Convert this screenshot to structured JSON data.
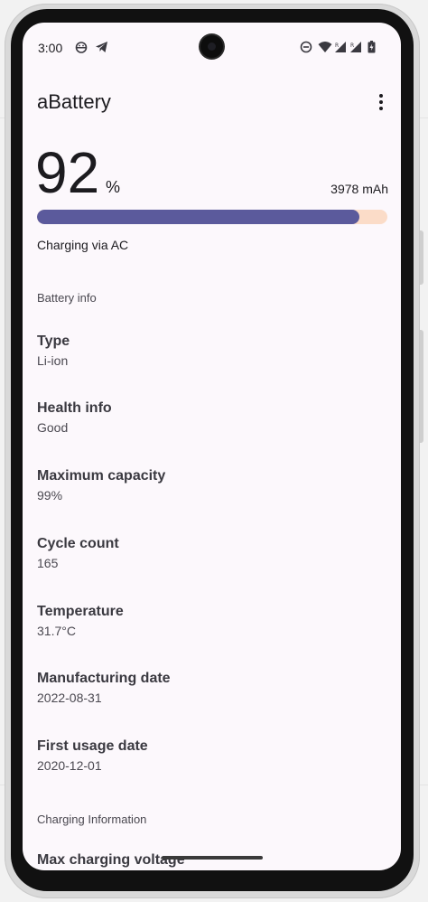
{
  "status_bar": {
    "time": "3:00",
    "left_icons": [
      "android-face-icon",
      "telegram-icon"
    ],
    "right_icons": [
      "do-not-disturb-icon",
      "wifi-icon",
      "signal-r-icon",
      "signal-r-icon",
      "battery-charging-icon"
    ],
    "roaming_mark": "R"
  },
  "app_bar": {
    "title": "aBattery",
    "menu_icon": "more-vert-icon"
  },
  "battery": {
    "level": "92",
    "percent_sign": "%",
    "level_fraction": 0.92,
    "capacity": "3978 mAh",
    "status": "Charging via AC",
    "fill_color": "#5b5a9c",
    "track_color": "#fbdcc8"
  },
  "sections": {
    "battery_info": "Battery info",
    "charging_info": "Charging Information"
  },
  "battery_info": [
    {
      "label": "Type",
      "value": "Li-ion"
    },
    {
      "label": "Health info",
      "value": "Good"
    },
    {
      "label": "Maximum capacity",
      "value": "99%"
    },
    {
      "label": "Cycle count",
      "value": "165"
    },
    {
      "label": "Temperature",
      "value": "31.7°C"
    },
    {
      "label": "Manufacturing date",
      "value": "2022-08-31"
    },
    {
      "label": "First usage date",
      "value": "2020-12-01"
    }
  ],
  "charging_info": [
    {
      "label": "Max charging voltage"
    }
  ]
}
